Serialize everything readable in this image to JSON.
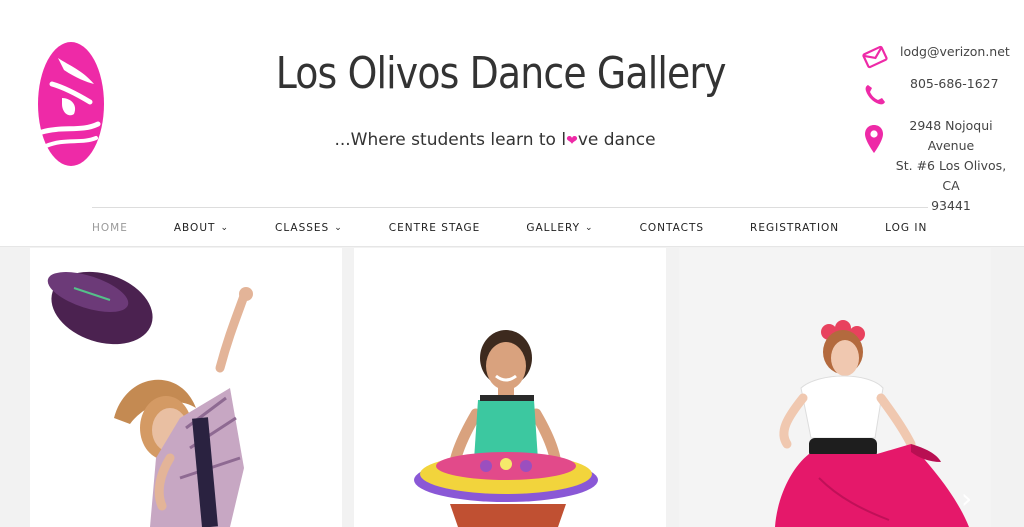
{
  "site": {
    "title": "Los Olivos Dance Gallery",
    "tagline_before": "...Where students learn to l",
    "tagline_after": "ve dance",
    "heart": "❤",
    "brand_color": "#ee2aa7"
  },
  "contact": {
    "email": "lodg@verizon.net",
    "phone": "805-686-1627",
    "address_line1": "2948 Nojoqui Avenue",
    "address_line2": "St. #6 Los Olivos, CA",
    "address_line3": "93441",
    "icons": [
      "envelope-icon",
      "phone-icon",
      "map-pin-icon"
    ]
  },
  "nav": {
    "items": [
      {
        "label": "HOME",
        "active": true,
        "dropdown": false
      },
      {
        "label": "ABOUT",
        "dropdown": true
      },
      {
        "label": "CLASSES",
        "dropdown": true
      },
      {
        "label": "CENTRE STAGE",
        "dropdown": false
      },
      {
        "label": "GALLERY",
        "dropdown": true
      },
      {
        "label": "CONTACTS",
        "dropdown": false
      },
      {
        "label": "REGISTRATION",
        "dropdown": false
      },
      {
        "label": "LOG IN",
        "dropdown": false
      }
    ]
  },
  "gallery": {
    "cards": [
      {
        "subject": "hip-hop dancer tossing a cap"
      },
      {
        "subject": "child in tutu dance costume"
      },
      {
        "subject": "folklorico dancer in pink skirt"
      }
    ],
    "next_arrow": "›"
  }
}
